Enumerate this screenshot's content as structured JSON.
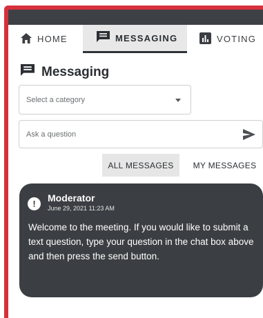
{
  "tabs": [
    {
      "label": "HOME",
      "icon": "home-icon"
    },
    {
      "label": "MESSAGING",
      "icon": "chat-icon"
    },
    {
      "label": "VOTING",
      "icon": "bar-chart-icon"
    }
  ],
  "active_tab": "MESSAGING",
  "heading": {
    "title": "Messaging",
    "icon": "chat-icon"
  },
  "category_select": {
    "value": "Select a category"
  },
  "question_input": {
    "placeholder": "Ask a question"
  },
  "filters": {
    "all": "ALL MESSAGES",
    "mine": "MY MESSAGES",
    "active": "ALL MESSAGES"
  },
  "messages": [
    {
      "author": "Moderator",
      "timestamp": "June 29, 2021 11:23 AM",
      "text": "Welcome to the meeting. If you would like to submit a text question, type your question in the chat box above and then press the send button."
    }
  ],
  "colors": {
    "accent": "#d6303c",
    "dark": "#3b3f43",
    "active_tab_bg": "#e8e8e8"
  }
}
